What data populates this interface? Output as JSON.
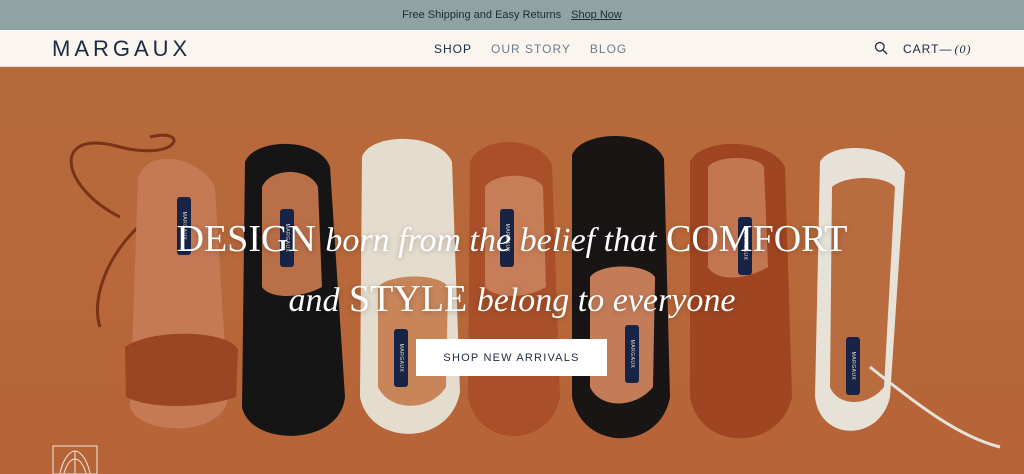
{
  "announcement": {
    "text": "Free Shipping and Easy Returns",
    "link": "Shop Now"
  },
  "brand": {
    "logo": "MARGAUX"
  },
  "nav": {
    "items": [
      {
        "label": "SHOP"
      },
      {
        "label": "OUR STORY"
      },
      {
        "label": "BLOG"
      }
    ]
  },
  "cart": {
    "label": "CART—",
    "count": "(0)"
  },
  "hero": {
    "line1_a": "DESIGN",
    "line1_b": "born from the belief that",
    "line1_c": "COMFORT",
    "line2_a": "and",
    "line2_b": "STYLE",
    "line2_c": "belong to everyone",
    "cta": "SHOP NEW ARRIVALS",
    "tag_text": "MARGAUX"
  },
  "colors": {
    "announce_bg": "#8fa3a3",
    "nav_bg": "#fbf5f0",
    "hero_bg": "#b66a3c",
    "ink": "#1c2a3f"
  }
}
